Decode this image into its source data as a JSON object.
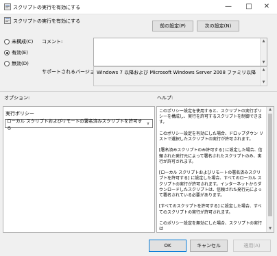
{
  "window": {
    "title": "スクリプトの実行を有効にする"
  },
  "header": {
    "policy_name": "スクリプトの実行を有効にする"
  },
  "nav": {
    "prev_label": "前の設定(P)",
    "next_label": "次の設定(N)"
  },
  "state": {
    "options": [
      {
        "label": "未構成(C)",
        "selected": false
      },
      {
        "label": "有効(E)",
        "selected": true
      },
      {
        "label": "無効(D)",
        "selected": false
      }
    ]
  },
  "comment": {
    "label": "コメント:",
    "value": ""
  },
  "supported": {
    "label": "サポートされるバージョン:",
    "value": "Windows 7 以降および Microsoft Windows Server 2008 ファミリ以降"
  },
  "options_section": {
    "label": "オプション:",
    "policy_label": "実行ポリシー",
    "selected_value": "ローカル スクリプトおよびリモートの署名済みスクリプトを許可する"
  },
  "help_section": {
    "label": "ヘルプ:",
    "text": "このポリシー設定を使用すると、スクリプトの実行ポリシーを構成し、実行を許可するスクリプトを制御できます。\n\nこのポリシー設定を有効にした場合、ドロップダウン リストで選択したスクリプトの実行が許可されます。\n\n[署名済みスクリプトのみ許可する] に設定した場合、信頼された発行元によって署名されたスクリプトのみ、実行が許可されます。\n\n[ローカル スクリプトおよびリモートの署名済みスクリプトを許可する] に設定した場合、すべてのローカル スクリプトの実行が許可されます。インターネットからダウンロードしたスクリプトは、信頼された発行元によって署名されている必要があります。\n\n[すべてのスクリプトを許可する] に設定した場合、すべてのスクリプトの実行が許可されます。\n\nこのポリシー設定を無効にした場合、スクリプトの実行は"
  },
  "footer": {
    "ok_label": "OK",
    "cancel_label": "キャンセル",
    "apply_label": "適用(A)"
  },
  "colors": {
    "disabled_text": "#a0a0a0",
    "window_bg": "#f0f0f0"
  }
}
